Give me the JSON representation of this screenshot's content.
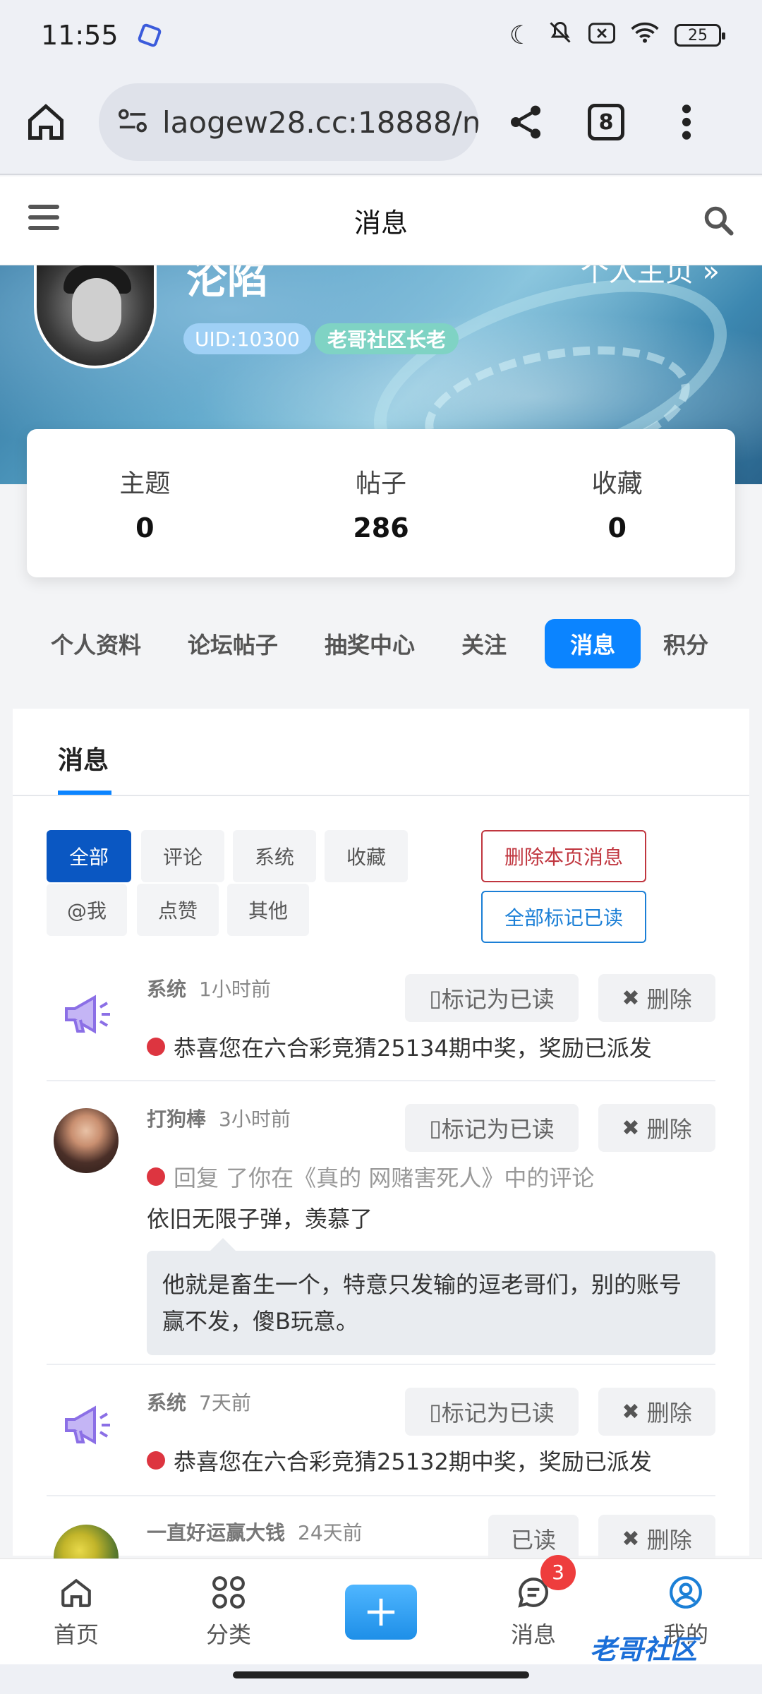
{
  "status_bar": {
    "time": "11:55",
    "battery": "25"
  },
  "browser": {
    "url": "laogew28.cc:18888/n",
    "tab_count": "8"
  },
  "header": {
    "title": "消息"
  },
  "profile": {
    "username": "沦陷",
    "home_link": "个人主页 »",
    "uid": "UID:10300",
    "rank": "老哥社区长老",
    "stats": [
      {
        "label": "主题",
        "value": "0"
      },
      {
        "label": "帖子",
        "value": "286"
      },
      {
        "label": "收藏",
        "value": "0"
      }
    ]
  },
  "section_tabs": [
    "个人资料",
    "论坛帖子",
    "抽奖中心",
    "关注",
    "消息",
    "积分"
  ],
  "panel": {
    "title": "消息",
    "filters": [
      "全部",
      "评论",
      "系统",
      "收藏",
      "@我",
      "点赞",
      "其他"
    ],
    "delete_page_label": "删除本页消息",
    "mark_all_label": "全部标记已读"
  },
  "messages": [
    {
      "sender": "系统",
      "time": "1小时前",
      "mark_label": "标记为已读",
      "delete_label": "删除",
      "text": "恭喜您在六合彩竞猜25134期中奖，奖励已派发"
    },
    {
      "sender": "打狗棒",
      "time": "3小时前",
      "mark_label": "标记为已读",
      "delete_label": "删除",
      "reply_prefix": "回复 了你在《真的 网赌害死人》中的评论",
      "reply_text": "依旧无限子弹，羡慕了",
      "quote": "他就是畜生一个，特意只发输的逗老哥们，别的账号赢不发，傻B玩意。"
    },
    {
      "sender": "系统",
      "time": "7天前",
      "mark_label": "标记为已读",
      "delete_label": "删除",
      "text": "恭喜您在六合彩竞猜25132期中奖，奖励已派发"
    },
    {
      "sender": "一直好运赢大钱",
      "time": "24天前",
      "mark_label": "已读",
      "delete_label": "删除"
    }
  ],
  "bottom_nav": [
    {
      "label": "首页"
    },
    {
      "label": "分类"
    },
    {
      "label": "消息",
      "badge": "3"
    },
    {
      "label": "我的"
    }
  ],
  "watermark": "老哥社区",
  "colors": {
    "accent": "#0b84ff",
    "filter_active": "#0a57c2",
    "danger": "#c0363f",
    "unread_dot": "#dd3540"
  }
}
